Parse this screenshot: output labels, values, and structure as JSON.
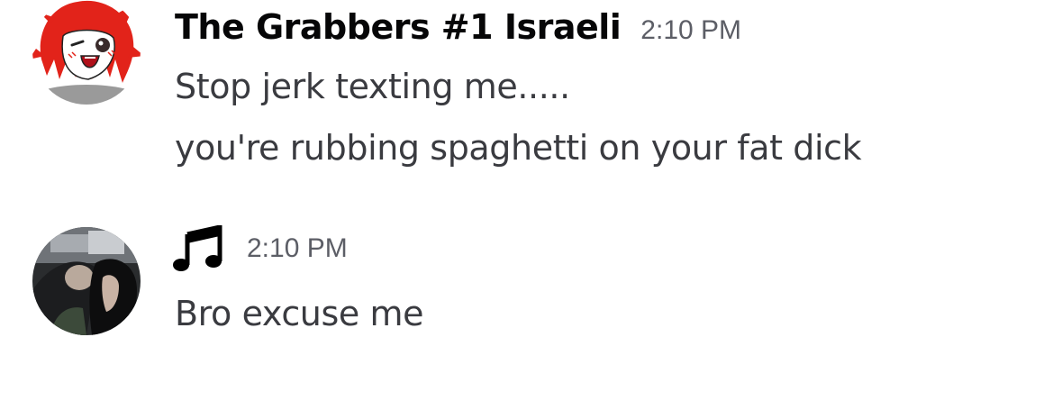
{
  "messages": [
    {
      "author": "The Grabbers #1 Israeli",
      "timestamp": "2:10 PM",
      "avatar_icon": "red-haired-anime-avatar",
      "lines": [
        "Stop jerk texting me.....",
        "you're rubbing spaghetti on your fat dick"
      ]
    },
    {
      "author_icon": "musical-notes-icon",
      "timestamp": "2:10 PM",
      "avatar_icon": "dark-photo-avatar",
      "lines": [
        "Bro excuse me"
      ]
    }
  ],
  "colors": {
    "background": "#ffffff",
    "username": "#060607",
    "message_text": "#3a3b40",
    "timestamp": "#5c5e66"
  }
}
